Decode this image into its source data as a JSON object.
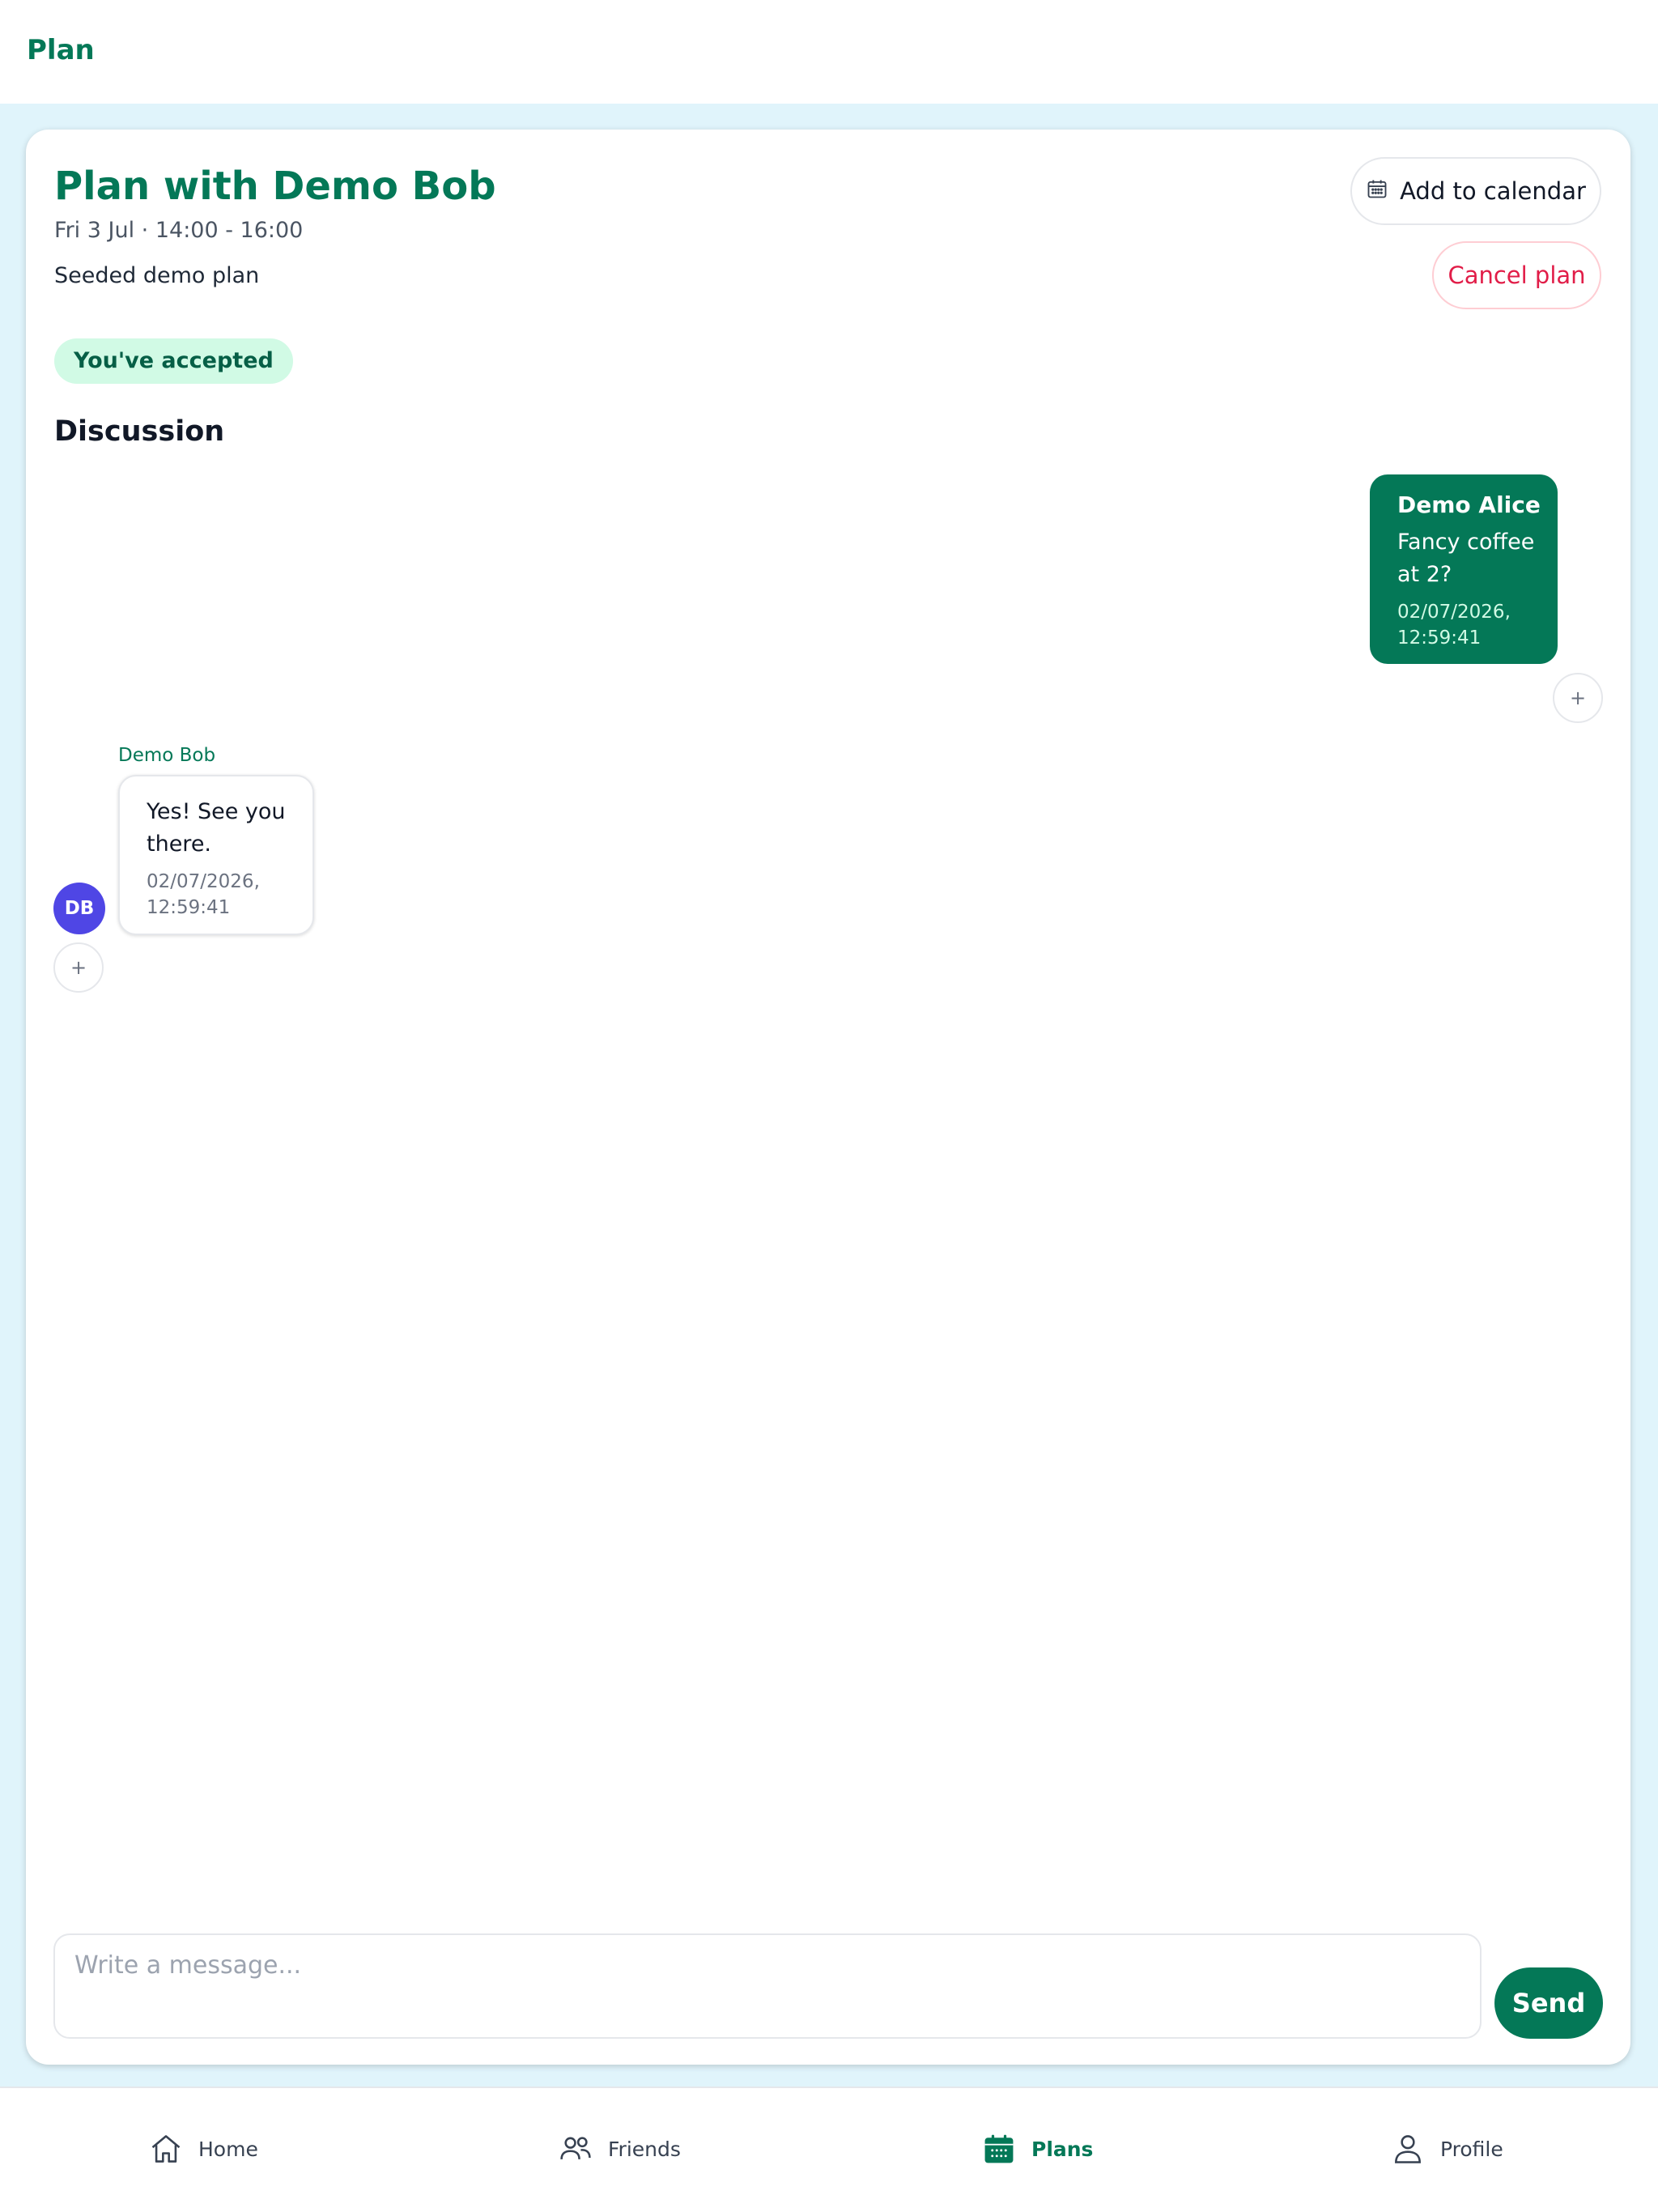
{
  "header": {
    "title": "Plan"
  },
  "plan": {
    "title": "Plan with Demo Bob",
    "when": "Fri 3 Jul · 14:00 - 16:00",
    "description": "Seeded demo plan",
    "status": "You've accepted",
    "add_to_calendar_label": "Add to calendar",
    "cancel_label": "Cancel plan"
  },
  "discussion": {
    "title": "Discussion",
    "messages": [
      {
        "sender": "Demo Alice",
        "text": "Fancy coffee at 2?",
        "time": "02/07/2026, 12:59:41",
        "own": true
      },
      {
        "sender": "Demo Bob",
        "initials": "DB",
        "text": "Yes! See you there.",
        "time": "02/07/2026, 12:59:41",
        "own": false
      }
    ],
    "react_label": "+"
  },
  "composer": {
    "placeholder": "Write a message...",
    "value": "",
    "send_label": "Send"
  },
  "nav": {
    "items": [
      {
        "label": "Home",
        "icon": "home-icon"
      },
      {
        "label": "Friends",
        "icon": "friends-icon"
      },
      {
        "label": "Plans",
        "icon": "calendar-icon",
        "active": true
      },
      {
        "label": "Profile",
        "icon": "profile-icon"
      }
    ]
  },
  "colors": {
    "brand": "#047857",
    "background": "#e0f4fb",
    "danger": "#e11d48",
    "badge_bg": "#d1fae5",
    "avatar": "#4f46e5"
  }
}
